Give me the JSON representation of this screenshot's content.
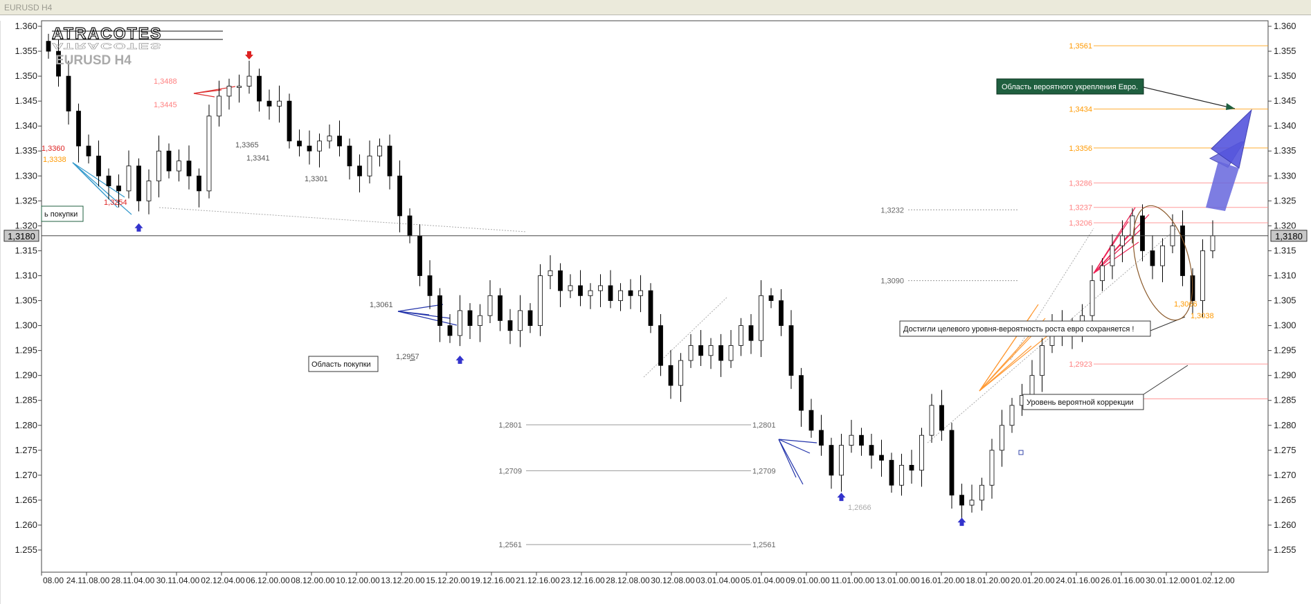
{
  "window": {
    "title": "EURUSD H4"
  },
  "brand": {
    "logo_text": "ATRACOTES",
    "symbol_label": "EURUSD H4"
  },
  "colors": {
    "bull": "#ffffff",
    "bear": "#000000",
    "fib_red": "#ff8080",
    "fib_orange": "#ff9900",
    "arrow_blue": "#5555dd",
    "buy_signal": "#3333cc",
    "sell_signal": "#dd2222",
    "callout_green": "#1f5f3f"
  },
  "chart_data": {
    "type": "candlestick",
    "symbol": "EURUSD",
    "timeframe": "H4",
    "current_price": "1,3180",
    "ylim": [
      1.251,
      1.362
    ],
    "y_ticks": [
      "1.360",
      "1.355",
      "1.350",
      "1.345",
      "1.340",
      "1.335",
      "1.330",
      "1.325",
      "1.320",
      "1.315",
      "1.310",
      "1.305",
      "1.300",
      "1.295",
      "1.290",
      "1.285",
      "1.280",
      "1.275",
      "1.270",
      "1.265",
      "1.260",
      "1.255"
    ],
    "x_ticks": [
      "08.00",
      "24.11.08.00",
      "28.11.04.00",
      "30.11.04.00",
      "02.12.04.00",
      "06.12.00.00",
      "08.12.00.00",
      "10.12.00.00",
      "13.12.20.00",
      "15.12.20.00",
      "19.12.16.00",
      "21.12.16.00",
      "23.12.16.00",
      "28.12.08.00",
      "30.12.08.00",
      "03.01.04.00",
      "05.01.04.00",
      "09.01.00.00",
      "11.01.00.00",
      "13.01.00.00",
      "16.01.20.00",
      "18.01.20.00",
      "20.01.20.00",
      "24.01.16.00",
      "26.01.16.00",
      "30.01.12.00",
      "01.02.12.00"
    ],
    "close_path": [
      [
        0,
        1.355
      ],
      [
        1,
        1.35
      ],
      [
        2,
        1.343
      ],
      [
        3,
        1.336
      ],
      [
        4,
        1.334
      ],
      [
        5,
        1.33
      ],
      [
        6,
        1.328
      ],
      [
        7,
        1.327
      ],
      [
        8,
        1.332
      ],
      [
        9,
        1.325
      ],
      [
        10,
        1.329
      ],
      [
        11,
        1.335
      ],
      [
        12,
        1.331
      ],
      [
        13,
        1.333
      ],
      [
        14,
        1.33
      ],
      [
        15,
        1.327
      ],
      [
        16,
        1.342
      ],
      [
        17,
        1.346
      ],
      [
        18,
        1.348
      ],
      [
        19,
        1.348
      ],
      [
        20,
        1.35
      ],
      [
        21,
        1.345
      ],
      [
        22,
        1.344
      ],
      [
        23,
        1.345
      ],
      [
        24,
        1.337
      ],
      [
        25,
        1.336
      ],
      [
        26,
        1.335
      ],
      [
        27,
        1.337
      ],
      [
        28,
        1.338
      ],
      [
        29,
        1.336
      ],
      [
        30,
        1.332
      ],
      [
        31,
        1.33
      ],
      [
        32,
        1.334
      ],
      [
        33,
        1.336
      ],
      [
        34,
        1.33
      ],
      [
        35,
        1.322
      ],
      [
        36,
        1.318
      ],
      [
        37,
        1.31
      ],
      [
        38,
        1.306
      ],
      [
        39,
        1.3
      ],
      [
        40,
        1.298
      ],
      [
        41,
        1.303
      ],
      [
        42,
        1.3
      ],
      [
        43,
        1.302
      ],
      [
        44,
        1.306
      ],
      [
        45,
        1.301
      ],
      [
        46,
        1.299
      ],
      [
        47,
        1.303
      ],
      [
        48,
        1.3
      ],
      [
        49,
        1.31
      ],
      [
        50,
        1.311
      ],
      [
        51,
        1.307
      ],
      [
        52,
        1.308
      ],
      [
        53,
        1.306
      ],
      [
        54,
        1.307
      ],
      [
        55,
        1.308
      ],
      [
        56,
        1.305
      ],
      [
        57,
        1.307
      ],
      [
        58,
        1.306
      ],
      [
        59,
        1.307
      ],
      [
        60,
        1.3
      ],
      [
        61,
        1.292
      ],
      [
        62,
        1.288
      ],
      [
        63,
        1.293
      ],
      [
        64,
        1.296
      ],
      [
        65,
        1.294
      ],
      [
        66,
        1.296
      ],
      [
        67,
        1.293
      ],
      [
        68,
        1.296
      ],
      [
        69,
        1.3
      ],
      [
        70,
        1.297
      ],
      [
        71,
        1.306
      ],
      [
        72,
        1.305
      ],
      [
        73,
        1.3
      ],
      [
        74,
        1.29
      ],
      [
        75,
        1.283
      ],
      [
        76,
        1.279
      ],
      [
        77,
        1.276
      ],
      [
        78,
        1.27
      ],
      [
        79,
        1.276
      ],
      [
        80,
        1.278
      ],
      [
        81,
        1.276
      ],
      [
        82,
        1.274
      ],
      [
        83,
        1.273
      ],
      [
        84,
        1.268
      ],
      [
        85,
        1.272
      ],
      [
        86,
        1.271
      ],
      [
        87,
        1.278
      ],
      [
        88,
        1.284
      ],
      [
        89,
        1.279
      ],
      [
        90,
        1.266
      ],
      [
        91,
        1.264
      ],
      [
        92,
        1.265
      ],
      [
        93,
        1.268
      ],
      [
        94,
        1.275
      ],
      [
        95,
        1.28
      ],
      [
        96,
        1.284
      ],
      [
        97,
        1.286
      ],
      [
        98,
        1.29
      ],
      [
        99,
        1.296
      ],
      [
        100,
        1.3
      ],
      [
        101,
        1.298
      ],
      [
        102,
        1.3
      ],
      [
        103,
        1.302
      ],
      [
        104,
        1.309
      ],
      [
        105,
        1.312
      ],
      [
        106,
        1.316
      ],
      [
        107,
        1.318
      ],
      [
        108,
        1.322
      ],
      [
        109,
        1.315
      ],
      [
        110,
        1.312
      ],
      [
        111,
        1.316
      ],
      [
        112,
        1.32
      ],
      [
        113,
        1.31
      ],
      [
        114,
        1.305
      ],
      [
        115,
        1.315
      ],
      [
        116,
        1.318
      ]
    ],
    "levels": [
      {
        "label": "1,3561",
        "price": 1.3561,
        "color": "#ff9900"
      },
      {
        "label": "1,3434",
        "price": 1.3434,
        "color": "#ff9900"
      },
      {
        "label": "1,3356",
        "price": 1.3356,
        "color": "#ff9900"
      },
      {
        "label": "1,3286",
        "price": 1.3286,
        "color": "#ff8080"
      },
      {
        "label": "1,3237",
        "price": 1.3237,
        "color": "#ff8080"
      },
      {
        "label": "1,3206",
        "price": 1.3206,
        "color": "#ff8080"
      },
      {
        "label": "1,2923",
        "price": 1.2923,
        "color": "#ff8080"
      },
      {
        "label": "1,2853",
        "price": 1.2853,
        "color": "#ff8080"
      }
    ],
    "grey_levels": [
      {
        "label": "1,2801",
        "price": 1.2801
      },
      {
        "label": "1,2709",
        "price": 1.2709
      },
      {
        "label": "1,2561",
        "price": 1.2561
      },
      {
        "label": "1,3232",
        "price": 1.3232
      },
      {
        "label": "1,3090",
        "price": 1.309
      }
    ],
    "price_labels": [
      {
        "text": "1,3488",
        "price": 1.3488,
        "color": "#ff8080"
      },
      {
        "text": "1,3445",
        "price": 1.3445,
        "color": "#ff8080"
      },
      {
        "text": "1,3360",
        "price": 1.336,
        "color": "#dd2222"
      },
      {
        "text": "1,3338",
        "price": 1.3338,
        "color": "#ff9900"
      },
      {
        "text": "1,3254",
        "price": 1.3254,
        "color": "#dd2222"
      },
      {
        "text": "1,3365",
        "price": 1.3365,
        "color": "#555555"
      },
      {
        "text": "1,3341",
        "price": 1.3341,
        "color": "#555555"
      },
      {
        "text": "1,3301",
        "price": 1.3301,
        "color": "#555555"
      },
      {
        "text": "1,3061",
        "price": 1.3061,
        "color": "#555555"
      },
      {
        "text": "1,2957",
        "price": 1.2957,
        "color": "#555555"
      },
      {
        "text": "1,2666",
        "price": 1.2666,
        "color": "#aaaaaa"
      },
      {
        "text": "1,3066",
        "price": 1.3066,
        "color": "#ff9900"
      },
      {
        "text": "1,3038",
        "price": 1.3038,
        "color": "#ff9900"
      }
    ],
    "buy_signals": [
      {
        "x_index": 9,
        "price": 1.3205
      },
      {
        "x_index": 41,
        "price": 1.294
      },
      {
        "x_index": 79,
        "price": 1.2665
      },
      {
        "x_index": 91,
        "price": 1.2615
      }
    ],
    "sell_signals": [
      {
        "x_index": 20,
        "price": 1.355
      }
    ]
  },
  "annotations": {
    "buy_zone_left": "ь покупки",
    "buy_zone": "Область покупки",
    "strengthen_zone": "Область вероятного укрепления Евро.",
    "target_reached": "Достигли целевого уровня-вероятность роста евро сохраняется !",
    "correction_level": "Уровень вероятной коррекции"
  }
}
